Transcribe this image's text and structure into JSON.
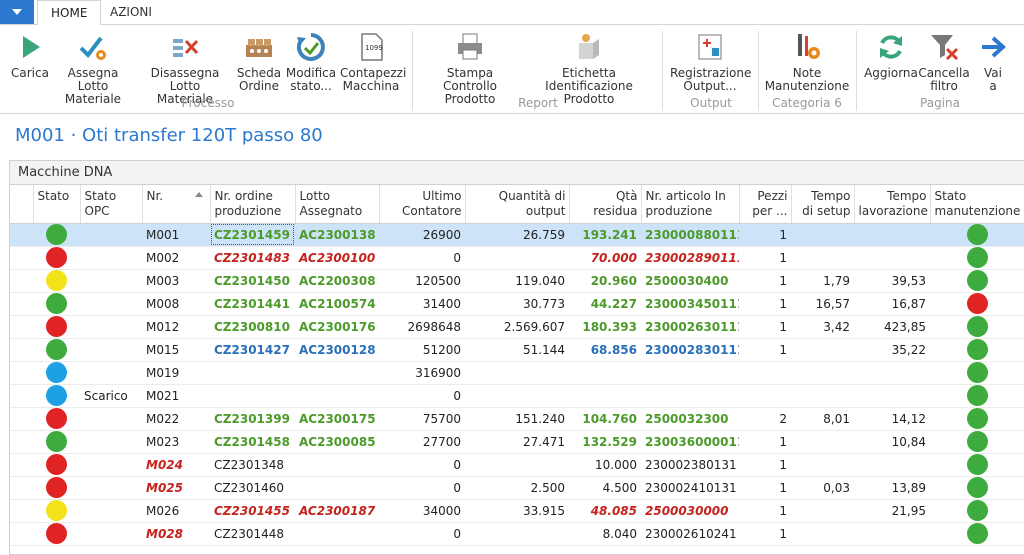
{
  "tabs": [
    "HOME",
    "AZIONI"
  ],
  "ribbon": {
    "buttons": [
      {
        "label1": "Carica",
        "label2": ""
      },
      {
        "label1": "Assegna Lotto",
        "label2": "Materiale"
      },
      {
        "label1": "Disassegna Lotto",
        "label2": "Materiale"
      },
      {
        "label1": "Scheda",
        "label2": "Ordine"
      },
      {
        "label1": "Modifica",
        "label2": "stato..."
      },
      {
        "label1": "Contapezzi",
        "label2": "Macchina"
      },
      {
        "label1": "Stampa Controllo",
        "label2": "Prodotto"
      },
      {
        "label1": "Etichetta",
        "label2": "Identificazione Prodotto"
      },
      {
        "label1": "Registrazione",
        "label2": "Output..."
      },
      {
        "label1": "Note",
        "label2": "Manutenzione"
      },
      {
        "label1": "Aggiorna",
        "label2": ""
      },
      {
        "label1": "Cancella",
        "label2": "filtro"
      },
      {
        "label1": "Vai",
        "label2": "a"
      }
    ],
    "groups": [
      "Processo",
      "Report",
      "Output",
      "Categoria 6",
      "Pagina"
    ]
  },
  "page_title": "M001 · Oti transfer 120T passo 80",
  "panel_title": "Macchine DNA",
  "columns": [
    {
      "l1": "Stato",
      "l2": ""
    },
    {
      "l1": "Stato",
      "l2": "OPC"
    },
    {
      "l1": "Nr.",
      "l2": ""
    },
    {
      "l1": "Nr. ordine",
      "l2": "produzione"
    },
    {
      "l1": "Lotto",
      "l2": "Assegnato"
    },
    {
      "l1": "Ultimo",
      "l2": "Contatore"
    },
    {
      "l1": "Quantità di",
      "l2": "output"
    },
    {
      "l1": "Qtà",
      "l2": "residua"
    },
    {
      "l1": "Nr. articolo In",
      "l2": "produzione"
    },
    {
      "l1": "Pezzi",
      "l2": "per ..."
    },
    {
      "l1": "Tempo",
      "l2": "di setup"
    },
    {
      "l1": "Tempo",
      "l2": "lavorazione"
    },
    {
      "l1": "Stato",
      "l2": "manutenzione"
    }
  ],
  "colors": {
    "green": "#3dab3d",
    "red": "#e02424",
    "yellow": "#f2e21a",
    "blue": "#1ea0e6",
    "accent": "#2b78d0"
  },
  "rows": [
    {
      "stato": "green",
      "opc": "",
      "nr": "M001",
      "ordine": "CZ2301459",
      "lotto": "AC2300138",
      "contatore": "26900",
      "output": "26.759",
      "residua": "193.241",
      "articolo": "230000880111",
      "pezzi": "1",
      "setup": "",
      "lavorazione": "",
      "manut": "green",
      "style": "green"
    },
    {
      "stato": "red",
      "opc": "",
      "nr": "M002",
      "ordine": "CZ2301483",
      "lotto": "AC2300100",
      "contatore": "0",
      "output": "",
      "residua": "70.000",
      "articolo": "230002890111",
      "pezzi": "1",
      "setup": "",
      "lavorazione": "",
      "manut": "green",
      "style": "red"
    },
    {
      "stato": "yellow",
      "opc": "",
      "nr": "M003",
      "ordine": "CZ2301450",
      "lotto": "AC2200308",
      "contatore": "120500",
      "output": "119.040",
      "residua": "20.960",
      "articolo": "2500030400",
      "pezzi": "1",
      "setup": "1,79",
      "lavorazione": "39,53",
      "manut": "green",
      "style": "green"
    },
    {
      "stato": "green",
      "opc": "",
      "nr": "M008",
      "ordine": "CZ2301441",
      "lotto": "AC2100574",
      "contatore": "31400",
      "output": "30.773",
      "residua": "44.227",
      "articolo": "230003450111",
      "pezzi": "1",
      "setup": "16,57",
      "lavorazione": "16,87",
      "manut": "red",
      "style": "green"
    },
    {
      "stato": "red",
      "opc": "",
      "nr": "M012",
      "ordine": "CZ2300810",
      "lotto": "AC2300176",
      "contatore": "2698648",
      "output": "2.569.607",
      "residua": "180.393",
      "articolo": "230002630111",
      "pezzi": "1",
      "setup": "3,42",
      "lavorazione": "423,85",
      "manut": "green",
      "style": "green"
    },
    {
      "stato": "green",
      "opc": "",
      "nr": "M015",
      "ordine": "CZ2301427",
      "lotto": "AC2300128",
      "contatore": "51200",
      "output": "51.144",
      "residua": "68.856",
      "articolo": "230002830111",
      "pezzi": "1",
      "setup": "",
      "lavorazione": "35,22",
      "manut": "green",
      "style": "blue"
    },
    {
      "stato": "blue",
      "opc": "",
      "nr": "M019",
      "ordine": "",
      "lotto": "",
      "contatore": "316900",
      "output": "",
      "residua": "",
      "articolo": "",
      "pezzi": "",
      "setup": "",
      "lavorazione": "",
      "manut": "green",
      "style": "plain"
    },
    {
      "stato": "blue",
      "opc": "Scarico",
      "nr": "M021",
      "ordine": "",
      "lotto": "",
      "contatore": "0",
      "output": "",
      "residua": "",
      "articolo": "",
      "pezzi": "",
      "setup": "",
      "lavorazione": "",
      "manut": "green",
      "style": "plain"
    },
    {
      "stato": "red",
      "opc": "",
      "nr": "M022",
      "ordine": "CZ2301399",
      "lotto": "AC2300175",
      "contatore": "75700",
      "output": "151.240",
      "residua": "104.760",
      "articolo": "2500032300",
      "pezzi": "2",
      "setup": "8,01",
      "lavorazione": "14,12",
      "manut": "green",
      "style": "green"
    },
    {
      "stato": "green",
      "opc": "",
      "nr": "M023",
      "ordine": "CZ2301458",
      "lotto": "AC2300085",
      "contatore": "27700",
      "output": "27.471",
      "residua": "132.529",
      "articolo": "230036000011",
      "pezzi": "1",
      "setup": "",
      "lavorazione": "10,84",
      "manut": "green",
      "style": "green"
    },
    {
      "stato": "red",
      "opc": "",
      "nr": "M024",
      "ordine": "CZ2301348",
      "lotto": "",
      "contatore": "0",
      "output": "",
      "residua": "10.000",
      "articolo": "230002380131",
      "pezzi": "1",
      "setup": "",
      "lavorazione": "",
      "manut": "green",
      "style": "nronly"
    },
    {
      "stato": "red",
      "opc": "",
      "nr": "M025",
      "ordine": "CZ2301460",
      "lotto": "",
      "contatore": "0",
      "output": "2.500",
      "residua": "4.500",
      "articolo": "230002410131",
      "pezzi": "1",
      "setup": "0,03",
      "lavorazione": "13,89",
      "manut": "green",
      "style": "nronly"
    },
    {
      "stato": "yellow",
      "opc": "",
      "nr": "M026",
      "ordine": "CZ2301455",
      "lotto": "AC2300187",
      "contatore": "34000",
      "output": "33.915",
      "residua": "48.085",
      "articolo": "2500030000",
      "pezzi": "1",
      "setup": "",
      "lavorazione": "21,95",
      "manut": "green",
      "style": "red"
    },
    {
      "stato": "red",
      "opc": "",
      "nr": "M028",
      "ordine": "CZ2301448",
      "lotto": "",
      "contatore": "0",
      "output": "",
      "residua": "8.040",
      "articolo": "230002610241",
      "pezzi": "1",
      "setup": "",
      "lavorazione": "",
      "manut": "green",
      "style": "nronly"
    }
  ]
}
